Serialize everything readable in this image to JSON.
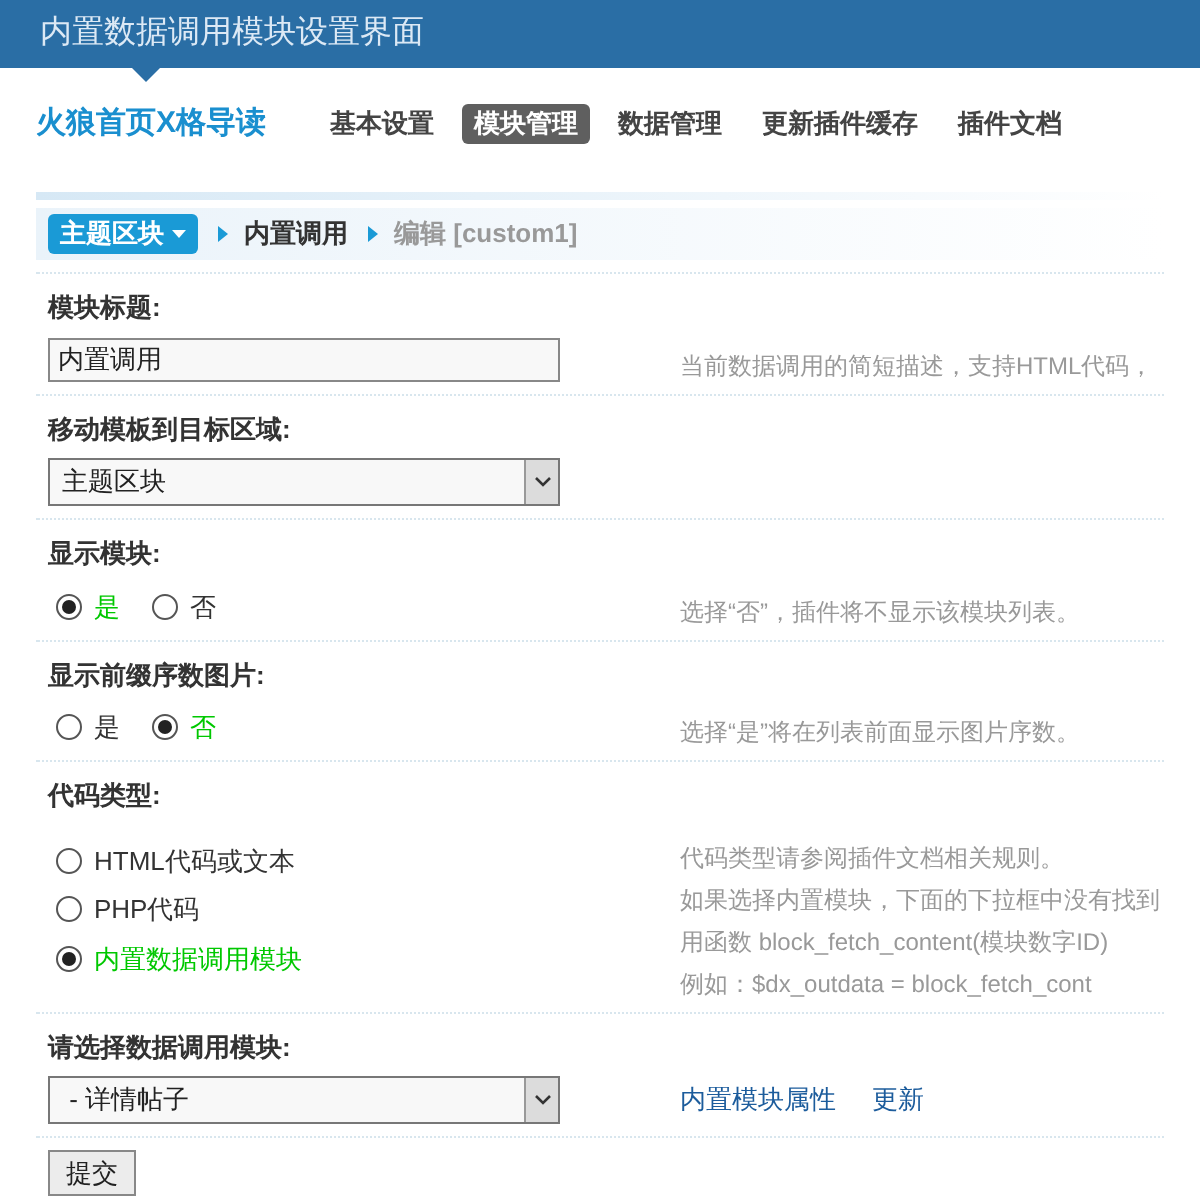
{
  "header": {
    "title": "内置数据调用模块设置界面"
  },
  "nav": {
    "brand": "火狼首页X格导读",
    "tabs": [
      {
        "label": "基本设置",
        "selected": false
      },
      {
        "label": "模块管理",
        "selected": true
      },
      {
        "label": "数据管理",
        "selected": false
      },
      {
        "label": "更新插件缓存",
        "selected": false
      },
      {
        "label": "插件文档",
        "selected": false
      }
    ]
  },
  "breadcrumb": {
    "dropdown": "主题区块",
    "items": [
      {
        "label": "内置调用",
        "kind": "current"
      },
      {
        "label": "编辑 [custom1]",
        "kind": "muted"
      }
    ]
  },
  "sections": [
    {
      "kind": "text",
      "label": "模块标题:",
      "value": "内置调用",
      "hints": [
        "当前数据调用的简短描述，支持HTML代码，"
      ]
    },
    {
      "kind": "select",
      "label": "移动模板到目标区域:",
      "value": "主题区块"
    },
    {
      "kind": "radio-row",
      "label": "显示模块:",
      "options": [
        {
          "label": "是",
          "selected": true
        },
        {
          "label": "否",
          "selected": false
        }
      ],
      "hints": [
        "选择“否”，插件将不显示该模块列表。"
      ]
    },
    {
      "kind": "radio-row",
      "label": "显示前缀序数图片:",
      "options": [
        {
          "label": "是",
          "selected": false
        },
        {
          "label": "否",
          "selected": true
        }
      ],
      "hints": [
        "选择“是”将在列表前面显示图片序数。"
      ]
    },
    {
      "kind": "radio-list",
      "label": "代码类型:",
      "options": [
        {
          "label": "HTML代码或文本",
          "selected": false
        },
        {
          "label": "PHP代码",
          "selected": false
        },
        {
          "label": "内置数据调用模块",
          "selected": true
        }
      ],
      "hints": [
        "代码类型请参阅插件文档相关规则。",
        "如果选择内置模块，下面的下拉框中没有找到",
        "用函数 block_fetch_content(模块数字ID)",
        "例如：$dx_outdata = block_fetch_cont"
      ]
    },
    {
      "kind": "select",
      "label": "请选择数据调用模块:",
      "value": " - 详情帖子",
      "links": [
        "内置模块属性",
        "更新"
      ]
    }
  ],
  "submit": "提交"
}
